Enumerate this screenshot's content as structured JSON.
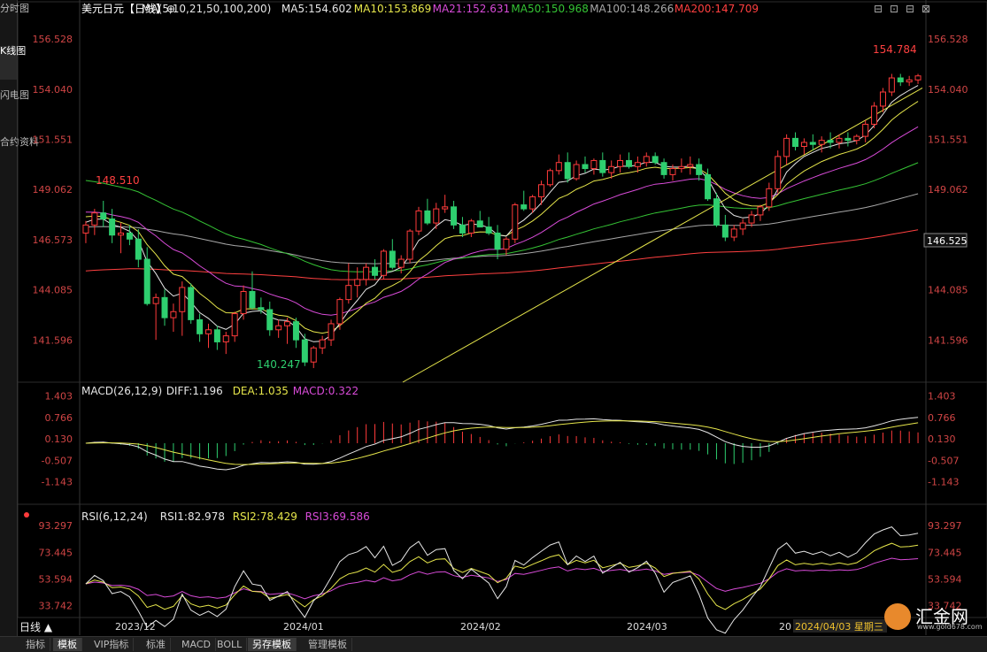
{
  "left_tabs": [
    "分时图",
    "K线图",
    "闪电图",
    "合约资料"
  ],
  "bottom_tabs": [
    "指标",
    "模板",
    "VIP指标",
    "标准",
    "MACD",
    "BOLL",
    "另存模板",
    "管理模板"
  ],
  "period_button": "日线 ▲",
  "logo": {
    "name": "汇金网",
    "url": "www.gold678.com"
  },
  "price_panel": {
    "header": [
      {
        "text": "美元日元【日线】⊕",
        "color": "#ffffff"
      },
      {
        "text": "MA(5,10,21,50,100,200)",
        "color": "#e6e6e6"
      },
      {
        "text": "MA5:154.602",
        "color": "#e6e6e6"
      },
      {
        "text": "MA10:153.869",
        "color": "#e6e64b"
      },
      {
        "text": "MA21:152.631",
        "color": "#d84bd8"
      },
      {
        "text": "MA50:150.968",
        "color": "#35c435"
      },
      {
        "text": "MA100:148.266",
        "color": "#a8a8a8"
      },
      {
        "text": "MA200:147.709",
        "color": "#ff4040"
      }
    ],
    "y_ticks": [
      "156.528",
      "154.040",
      "151.551",
      "149.062",
      "146.573",
      "144.085",
      "141.596"
    ],
    "current_price": "146.525",
    "high_label": "154.784",
    "annot_high_left": "148.510",
    "annot_low": "140.247"
  },
  "macd_panel": {
    "header": [
      {
        "text": "MACD(26,12,9)",
        "color": "#e6e6e6"
      },
      {
        "text": "DIFF:1.196",
        "color": "#e6e6e6"
      },
      {
        "text": "DEA:1.035",
        "color": "#e6e64b"
      },
      {
        "text": "MACD:0.322",
        "color": "#d84bd8"
      }
    ],
    "y_ticks": [
      "1.403",
      "0.766",
      "0.130",
      "-0.507",
      "-1.143"
    ]
  },
  "rsi_panel": {
    "header": [
      {
        "text": "RSI(6,12,24)",
        "color": "#e6e6e6"
      },
      {
        "text": "RSI1:82.978",
        "color": "#e6e6e6"
      },
      {
        "text": "RSI2:78.429",
        "color": "#e6e64b"
      },
      {
        "text": "RSI3:69.586",
        "color": "#d84bd8"
      }
    ],
    "y_ticks": [
      "93.297",
      "73.445",
      "53.594",
      "33.742"
    ]
  },
  "x_labels": [
    "2023/12",
    "2024/01",
    "2024/02",
    "2024/03",
    "20"
  ],
  "cursor_date": "2024/04/03 星期三",
  "window_buttons": [
    "⊟",
    "⊡",
    "⊟",
    "⊠"
  ],
  "chart_data": {
    "type": "candlestick",
    "symbol": "美元日元",
    "period": "日线",
    "ylim": [
      139.5,
      157.5
    ],
    "ohlc": [
      [
        146.9,
        147.5,
        146.4,
        147.3
      ],
      [
        147.3,
        148.1,
        146.8,
        147.9
      ],
      [
        147.9,
        148.5,
        147.2,
        147.6
      ],
      [
        147.6,
        148.1,
        146.4,
        146.8
      ],
      [
        146.8,
        147.4,
        145.9,
        146.9
      ],
      [
        146.9,
        147.3,
        146.3,
        146.6
      ],
      [
        146.6,
        147.1,
        145.2,
        145.6
      ],
      [
        145.6,
        146.2,
        143.3,
        143.4
      ],
      [
        143.4,
        143.9,
        141.6,
        143.7
      ],
      [
        143.7,
        144.1,
        142.3,
        142.7
      ],
      [
        142.7,
        143.4,
        142.0,
        143.0
      ],
      [
        143.0,
        144.5,
        141.8,
        144.2
      ],
      [
        144.2,
        144.4,
        142.4,
        142.6
      ],
      [
        142.6,
        142.9,
        141.5,
        141.9
      ],
      [
        141.9,
        142.4,
        141.2,
        142.1
      ],
      [
        142.1,
        142.3,
        141.1,
        141.5
      ],
      [
        141.5,
        142.0,
        140.9,
        141.8
      ],
      [
        141.8,
        143.0,
        141.5,
        142.9
      ],
      [
        142.9,
        144.3,
        142.6,
        144.0
      ],
      [
        144.0,
        145.0,
        143.1,
        143.2
      ],
      [
        143.2,
        143.7,
        142.9,
        143.1
      ],
      [
        143.1,
        143.5,
        141.8,
        142.1
      ],
      [
        142.1,
        142.6,
        141.7,
        142.3
      ],
      [
        142.3,
        142.7,
        141.4,
        142.5
      ],
      [
        142.5,
        142.7,
        141.2,
        141.6
      ],
      [
        141.6,
        141.9,
        140.3,
        140.5
      ],
      [
        140.5,
        141.3,
        140.2,
        141.2
      ],
      [
        141.2,
        141.8,
        140.9,
        141.6
      ],
      [
        141.6,
        142.6,
        141.3,
        142.4
      ],
      [
        142.4,
        143.7,
        142.1,
        143.6
      ],
      [
        143.6,
        145.4,
        143.4,
        144.3
      ],
      [
        144.3,
        145.2,
        143.7,
        144.6
      ],
      [
        144.6,
        145.4,
        144.3,
        145.2
      ],
      [
        145.2,
        145.6,
        144.6,
        144.8
      ],
      [
        144.8,
        146.1,
        144.6,
        146.0
      ],
      [
        146.0,
        146.6,
        145.1,
        145.2
      ],
      [
        145.2,
        145.8,
        144.9,
        145.6
      ],
      [
        145.6,
        147.1,
        145.4,
        147.0
      ],
      [
        147.0,
        148.2,
        146.8,
        148.0
      ],
      [
        148.0,
        148.6,
        147.3,
        147.4
      ],
      [
        147.4,
        148.4,
        147.1,
        148.1
      ],
      [
        148.1,
        148.8,
        147.9,
        148.2
      ],
      [
        148.2,
        148.5,
        147.1,
        147.3
      ],
      [
        147.3,
        147.7,
        146.7,
        146.9
      ],
      [
        146.9,
        147.6,
        146.7,
        147.5
      ],
      [
        147.5,
        148.0,
        147.2,
        147.2
      ],
      [
        147.2,
        147.7,
        146.8,
        146.9
      ],
      [
        146.9,
        147.3,
        145.6,
        146.1
      ],
      [
        146.1,
        146.7,
        145.8,
        146.6
      ],
      [
        146.6,
        148.4,
        146.4,
        148.3
      ],
      [
        148.3,
        149.0,
        148.0,
        148.1
      ],
      [
        148.1,
        148.8,
        147.9,
        148.7
      ],
      [
        148.7,
        149.5,
        148.3,
        149.3
      ],
      [
        149.3,
        150.1,
        149.2,
        150.0
      ],
      [
        150.0,
        150.8,
        149.8,
        150.4
      ],
      [
        150.4,
        150.9,
        149.4,
        149.6
      ],
      [
        149.6,
        150.5,
        149.5,
        150.3
      ],
      [
        150.3,
        150.7,
        149.9,
        150.1
      ],
      [
        150.1,
        150.6,
        149.8,
        150.5
      ],
      [
        150.5,
        150.9,
        149.7,
        149.9
      ],
      [
        149.9,
        150.5,
        149.6,
        150.2
      ],
      [
        150.2,
        150.8,
        149.9,
        150.5
      ],
      [
        150.5,
        150.9,
        150.1,
        150.2
      ],
      [
        150.2,
        150.7,
        149.9,
        150.4
      ],
      [
        150.4,
        150.9,
        150.2,
        150.7
      ],
      [
        150.7,
        150.9,
        150.3,
        150.4
      ],
      [
        150.4,
        150.6,
        149.6,
        149.8
      ],
      [
        149.8,
        150.3,
        149.5,
        150.1
      ],
      [
        150.1,
        150.6,
        149.9,
        150.2
      ],
      [
        150.2,
        150.7,
        149.8,
        150.3
      ],
      [
        150.3,
        150.6,
        149.5,
        149.8
      ],
      [
        149.8,
        150.1,
        148.5,
        148.6
      ],
      [
        148.6,
        148.9,
        147.2,
        147.3
      ],
      [
        147.3,
        147.8,
        146.5,
        146.7
      ],
      [
        146.7,
        147.3,
        146.5,
        147.1
      ],
      [
        147.1,
        147.6,
        146.8,
        147.4
      ],
      [
        147.4,
        148.0,
        147.2,
        147.8
      ],
      [
        147.8,
        148.3,
        147.5,
        148.2
      ],
      [
        148.2,
        149.4,
        148.0,
        149.1
      ],
      [
        149.1,
        151.0,
        148.9,
        150.7
      ],
      [
        150.7,
        151.8,
        150.3,
        151.6
      ],
      [
        151.6,
        151.9,
        151.0,
        151.2
      ],
      [
        151.2,
        151.6,
        150.8,
        151.4
      ],
      [
        151.4,
        151.8,
        151.0,
        151.3
      ],
      [
        151.3,
        151.7,
        150.9,
        151.5
      ],
      [
        151.5,
        151.9,
        151.1,
        151.4
      ],
      [
        151.4,
        151.8,
        151.1,
        151.6
      ],
      [
        151.6,
        151.9,
        151.2,
        151.5
      ],
      [
        151.5,
        151.8,
        151.3,
        151.7
      ],
      [
        151.7,
        152.5,
        151.4,
        152.3
      ],
      [
        152.3,
        153.4,
        152.1,
        153.2
      ],
      [
        153.2,
        154.1,
        152.9,
        153.9
      ],
      [
        153.9,
        154.8,
        153.7,
        154.6
      ],
      [
        154.6,
        154.8,
        154.2,
        154.4
      ],
      [
        154.4,
        154.7,
        154.2,
        154.5
      ],
      [
        154.5,
        154.8,
        154.3,
        154.7
      ]
    ],
    "annotations": [
      "154.784",
      "148.510",
      "140.247"
    ]
  }
}
